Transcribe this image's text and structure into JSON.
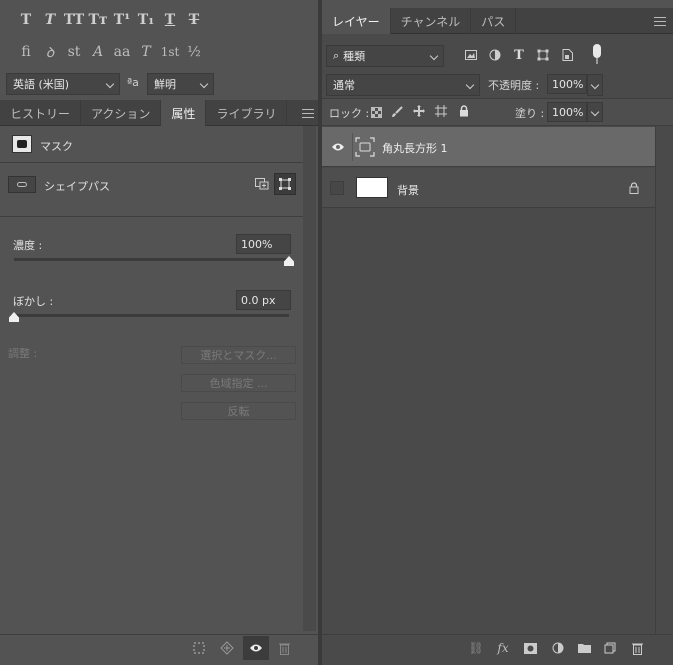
{
  "left": {
    "type_buttons_row1": [
      "T",
      "T",
      "TT",
      "Tт",
      "T¹",
      "T₁",
      "T",
      "T"
    ],
    "type_buttons_row2": [
      "fi",
      "ꝺ",
      "st",
      "A",
      "aa",
      "T",
      "1st",
      "½"
    ],
    "language_select": "英語 (米国)",
    "aa_label": "ªa",
    "antialias_select": "鮮明",
    "tabs": [
      "ヒストリー",
      "アクション",
      "属性",
      "ライブラリ"
    ],
    "properties": {
      "mask_label": "マスク",
      "shape_path_label": "シェイプパス",
      "density_label": "濃度 :",
      "density_value": "100%",
      "feather_label": "ぼかし :",
      "feather_value": "0.0 px",
      "adjust_label": "調整 :",
      "select_mask_button": "選択とマスク...",
      "color_range_button": "色域指定 ...",
      "invert_button": "反転"
    }
  },
  "right": {
    "tabs": [
      "レイヤー",
      "チャンネル",
      "パス"
    ],
    "filter_select": "種類",
    "blend_mode": "通常",
    "opacity_label": "不透明度 :",
    "opacity_value": "100%",
    "lock_label": "ロック :",
    "fill_label": "塗り :",
    "fill_value": "100%",
    "layers": [
      {
        "name": "角丸長方形 1",
        "selected": true,
        "visible": true
      },
      {
        "name": "背景",
        "selected": false,
        "visible": false
      }
    ]
  }
}
